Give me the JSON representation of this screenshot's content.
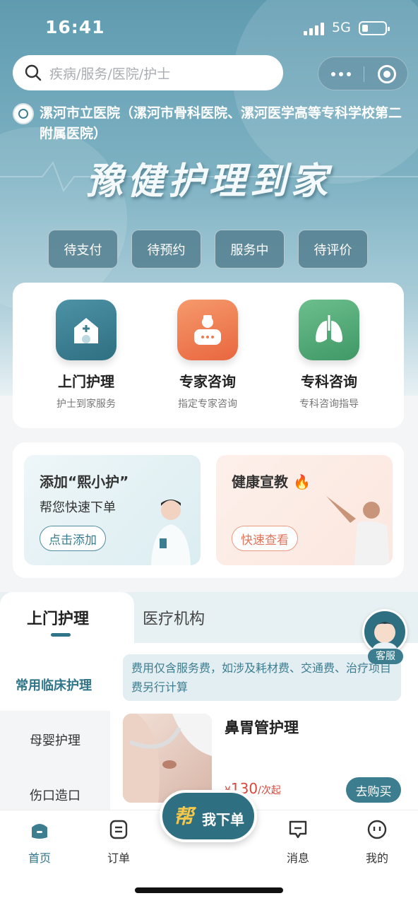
{
  "status_bar": {
    "time": "16:41",
    "network": "5G"
  },
  "search": {
    "placeholder": "疾病/服务/医院/护士"
  },
  "hospital": {
    "name": "漯河市立医院（漯河市骨科医院、漯河医学高等专科学校第二附属医院）"
  },
  "slogan": "豫健护理到家",
  "order_pills": [
    "待支付",
    "待预约",
    "服务中",
    "待评价"
  ],
  "services": [
    {
      "title": "上门护理",
      "subtitle": "护士到家服务",
      "icon": "home-plus-icon",
      "color": "#3d7d90"
    },
    {
      "title": "专家咨询",
      "subtitle": "指定专家咨询",
      "icon": "doctor-icon",
      "color": "#ef7a52"
    },
    {
      "title": "专科咨询",
      "subtitle": "专科咨询指导",
      "icon": "lungs-icon",
      "color": "#54a878"
    }
  ],
  "promo": {
    "left": {
      "title": "添加“熙小护”",
      "subtitle": "帮您快速下单",
      "button": "点击添加"
    },
    "right": {
      "title": "健康宣教",
      "button": "快速查看"
    }
  },
  "tabs": {
    "active": "上门护理",
    "inactive": "医疗机构"
  },
  "sidebar": {
    "items": [
      "常用临床护理",
      "母婴护理",
      "伤口造口"
    ]
  },
  "notice": "费用仅含服务费，如涉及耗材费、交通费、治疗项目费另行计算",
  "product": {
    "name": "鼻胃管护理",
    "price_symbol": "¥",
    "price": "130",
    "price_unit": "/次起",
    "buy_label": "去购买"
  },
  "customer_service": "客服",
  "fab": {
    "mark": "帮",
    "label": "我下单"
  },
  "tabbar": {
    "items": [
      "首页",
      "订单",
      "消息",
      "我的"
    ],
    "active": "首页"
  },
  "colors": {
    "primary": "#2f7488",
    "price": "#d9463a"
  }
}
